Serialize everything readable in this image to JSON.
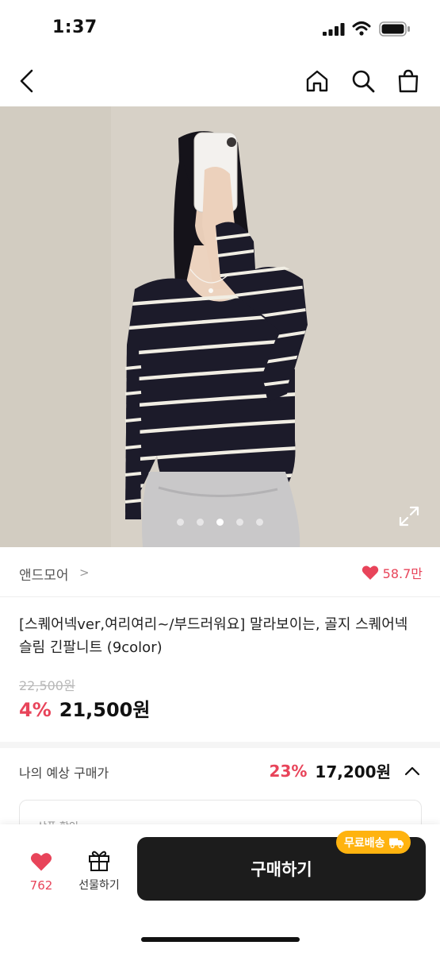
{
  "status": {
    "time": "1:37"
  },
  "brand": {
    "name": "앤드모어",
    "likes": "58.7만"
  },
  "product": {
    "title": "[스퀘어넥ver,여리여리~/부드러워요] 말라보이는, 골지 스퀘어넥 슬림 긴팔니트 (9color)",
    "original_price": "22,500원",
    "discount": "4%",
    "price": "21,500원"
  },
  "estimate": {
    "label": "나의 예상 구매가",
    "discount": "23%",
    "price": "17,200원"
  },
  "coupon_card": {
    "label": "상품 할인"
  },
  "bottom": {
    "wish_count": "762",
    "gift_label": "선물하기",
    "buy_label": "구매하기",
    "free_shipping": "무료배송"
  },
  "carousel": {
    "total": 5,
    "active": 3
  },
  "colors": {
    "accent": "#e8445a",
    "buy_button": "#1c1c1c",
    "badge": "#ffb30f"
  }
}
